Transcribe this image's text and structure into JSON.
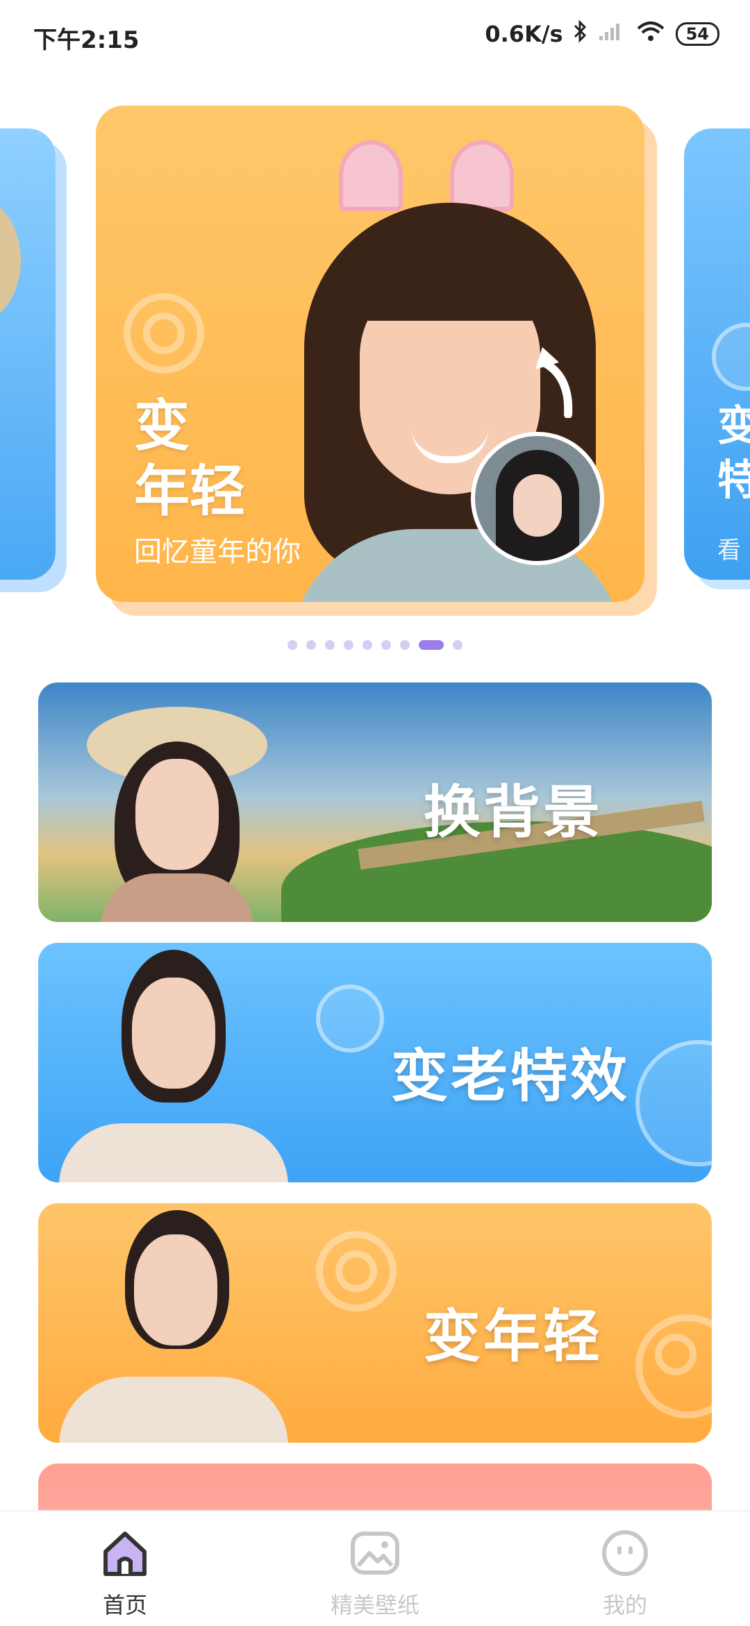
{
  "status_bar": {
    "time": "下午2:15",
    "network_speed": "0.6K/s",
    "battery": "54",
    "icons": [
      "bluetooth-icon",
      "signal-icon",
      "wifi-icon",
      "battery-icon"
    ]
  },
  "carousel": {
    "main_card": {
      "title_line1": "变",
      "title_line2": "年轻",
      "subtitle": "回忆童年的你"
    },
    "right_card": {
      "title_line1": "变",
      "title_line2": "特",
      "subtitle": "看"
    },
    "dot_count": 9,
    "active_dot_index": 7
  },
  "banners": [
    {
      "title": "换背景"
    },
    {
      "title": "变老特效"
    },
    {
      "title": "变年轻"
    }
  ],
  "bottom_nav": {
    "items": [
      {
        "label": "首页",
        "icon": "home-icon",
        "active": true
      },
      {
        "label": "精美壁纸",
        "icon": "wallpaper-icon",
        "active": false
      },
      {
        "label": "我的",
        "icon": "profile-icon",
        "active": false
      }
    ]
  },
  "colors": {
    "accent_purple": "#9a7de9",
    "orange_card": "#ffb54a",
    "blue_card": "#3ea3f5"
  }
}
